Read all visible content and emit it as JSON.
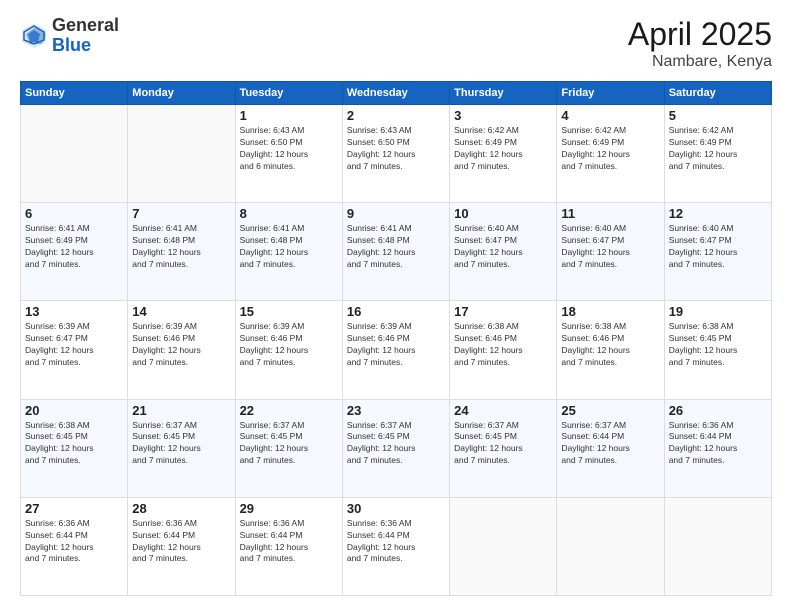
{
  "logo": {
    "general": "General",
    "blue": "Blue"
  },
  "title": "April 2025",
  "location": "Nambare, Kenya",
  "days": [
    "Sunday",
    "Monday",
    "Tuesday",
    "Wednesday",
    "Thursday",
    "Friday",
    "Saturday"
  ],
  "weeks": [
    [
      {
        "day": "",
        "content": ""
      },
      {
        "day": "",
        "content": ""
      },
      {
        "day": "1",
        "content": "Sunrise: 6:43 AM\nSunset: 6:50 PM\nDaylight: 12 hours\nand 6 minutes."
      },
      {
        "day": "2",
        "content": "Sunrise: 6:43 AM\nSunset: 6:50 PM\nDaylight: 12 hours\nand 7 minutes."
      },
      {
        "day": "3",
        "content": "Sunrise: 6:42 AM\nSunset: 6:49 PM\nDaylight: 12 hours\nand 7 minutes."
      },
      {
        "day": "4",
        "content": "Sunrise: 6:42 AM\nSunset: 6:49 PM\nDaylight: 12 hours\nand 7 minutes."
      },
      {
        "day": "5",
        "content": "Sunrise: 6:42 AM\nSunset: 6:49 PM\nDaylight: 12 hours\nand 7 minutes."
      }
    ],
    [
      {
        "day": "6",
        "content": "Sunrise: 6:41 AM\nSunset: 6:49 PM\nDaylight: 12 hours\nand 7 minutes."
      },
      {
        "day": "7",
        "content": "Sunrise: 6:41 AM\nSunset: 6:48 PM\nDaylight: 12 hours\nand 7 minutes."
      },
      {
        "day": "8",
        "content": "Sunrise: 6:41 AM\nSunset: 6:48 PM\nDaylight: 12 hours\nand 7 minutes."
      },
      {
        "day": "9",
        "content": "Sunrise: 6:41 AM\nSunset: 6:48 PM\nDaylight: 12 hours\nand 7 minutes."
      },
      {
        "day": "10",
        "content": "Sunrise: 6:40 AM\nSunset: 6:47 PM\nDaylight: 12 hours\nand 7 minutes."
      },
      {
        "day": "11",
        "content": "Sunrise: 6:40 AM\nSunset: 6:47 PM\nDaylight: 12 hours\nand 7 minutes."
      },
      {
        "day": "12",
        "content": "Sunrise: 6:40 AM\nSunset: 6:47 PM\nDaylight: 12 hours\nand 7 minutes."
      }
    ],
    [
      {
        "day": "13",
        "content": "Sunrise: 6:39 AM\nSunset: 6:47 PM\nDaylight: 12 hours\nand 7 minutes."
      },
      {
        "day": "14",
        "content": "Sunrise: 6:39 AM\nSunset: 6:46 PM\nDaylight: 12 hours\nand 7 minutes."
      },
      {
        "day": "15",
        "content": "Sunrise: 6:39 AM\nSunset: 6:46 PM\nDaylight: 12 hours\nand 7 minutes."
      },
      {
        "day": "16",
        "content": "Sunrise: 6:39 AM\nSunset: 6:46 PM\nDaylight: 12 hours\nand 7 minutes."
      },
      {
        "day": "17",
        "content": "Sunrise: 6:38 AM\nSunset: 6:46 PM\nDaylight: 12 hours\nand 7 minutes."
      },
      {
        "day": "18",
        "content": "Sunrise: 6:38 AM\nSunset: 6:46 PM\nDaylight: 12 hours\nand 7 minutes."
      },
      {
        "day": "19",
        "content": "Sunrise: 6:38 AM\nSunset: 6:45 PM\nDaylight: 12 hours\nand 7 minutes."
      }
    ],
    [
      {
        "day": "20",
        "content": "Sunrise: 6:38 AM\nSunset: 6:45 PM\nDaylight: 12 hours\nand 7 minutes."
      },
      {
        "day": "21",
        "content": "Sunrise: 6:37 AM\nSunset: 6:45 PM\nDaylight: 12 hours\nand 7 minutes."
      },
      {
        "day": "22",
        "content": "Sunrise: 6:37 AM\nSunset: 6:45 PM\nDaylight: 12 hours\nand 7 minutes."
      },
      {
        "day": "23",
        "content": "Sunrise: 6:37 AM\nSunset: 6:45 PM\nDaylight: 12 hours\nand 7 minutes."
      },
      {
        "day": "24",
        "content": "Sunrise: 6:37 AM\nSunset: 6:45 PM\nDaylight: 12 hours\nand 7 minutes."
      },
      {
        "day": "25",
        "content": "Sunrise: 6:37 AM\nSunset: 6:44 PM\nDaylight: 12 hours\nand 7 minutes."
      },
      {
        "day": "26",
        "content": "Sunrise: 6:36 AM\nSunset: 6:44 PM\nDaylight: 12 hours\nand 7 minutes."
      }
    ],
    [
      {
        "day": "27",
        "content": "Sunrise: 6:36 AM\nSunset: 6:44 PM\nDaylight: 12 hours\nand 7 minutes."
      },
      {
        "day": "28",
        "content": "Sunrise: 6:36 AM\nSunset: 6:44 PM\nDaylight: 12 hours\nand 7 minutes."
      },
      {
        "day": "29",
        "content": "Sunrise: 6:36 AM\nSunset: 6:44 PM\nDaylight: 12 hours\nand 7 minutes."
      },
      {
        "day": "30",
        "content": "Sunrise: 6:36 AM\nSunset: 6:44 PM\nDaylight: 12 hours\nand 7 minutes."
      },
      {
        "day": "",
        "content": ""
      },
      {
        "day": "",
        "content": ""
      },
      {
        "day": "",
        "content": ""
      }
    ]
  ]
}
